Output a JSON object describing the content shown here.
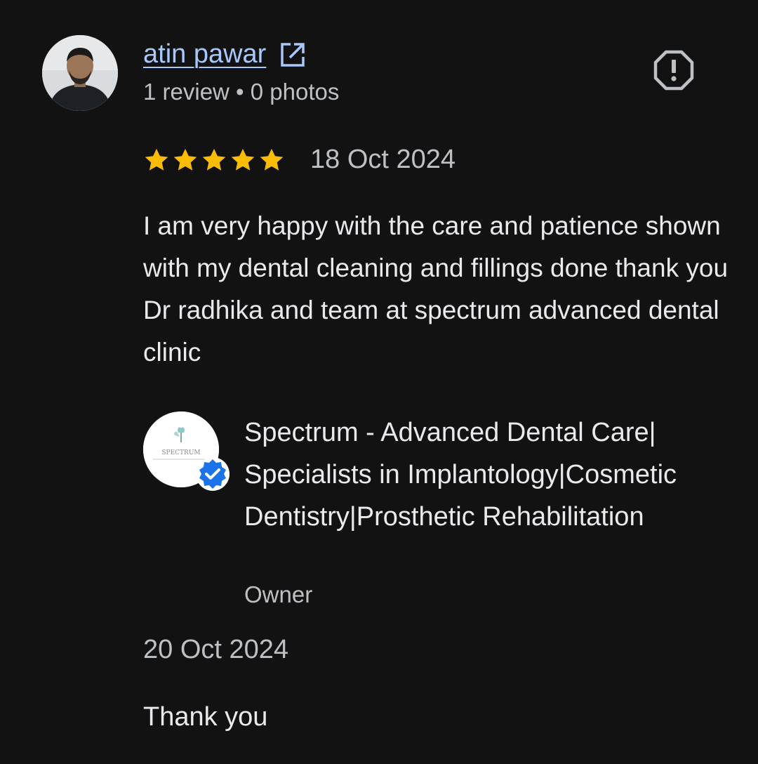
{
  "review": {
    "author_name": "atin pawar",
    "author_meta": "1 review • 0 photos",
    "rating": 5,
    "rating_max": 5,
    "date": "18 Oct 2024",
    "text": "I am very happy with the care and patience shown with my dental cleaning and fillings done thank you Dr radhika and team at spectrum advanced dental clinic"
  },
  "owner_reply": {
    "business_name": "Spectrum - Advanced Dental Care| Specialists in Implantology|Cosmetic Dentistry|Prosthetic Rehabilitation",
    "role": "Owner",
    "logo_text": "SPECTRUM",
    "date": "20 Oct 2024",
    "text": "Thank you"
  },
  "icons": {
    "external_link": "external-link-icon",
    "report": "report-icon",
    "star": "star-icon",
    "verified": "verified-check-icon"
  },
  "colors": {
    "background": "#121212",
    "link": "#a8c7fa",
    "star": "#fbbc04",
    "verified": "#1a73e8",
    "secondary_text": "#bdc1c6",
    "primary_text": "#e8eaed"
  }
}
